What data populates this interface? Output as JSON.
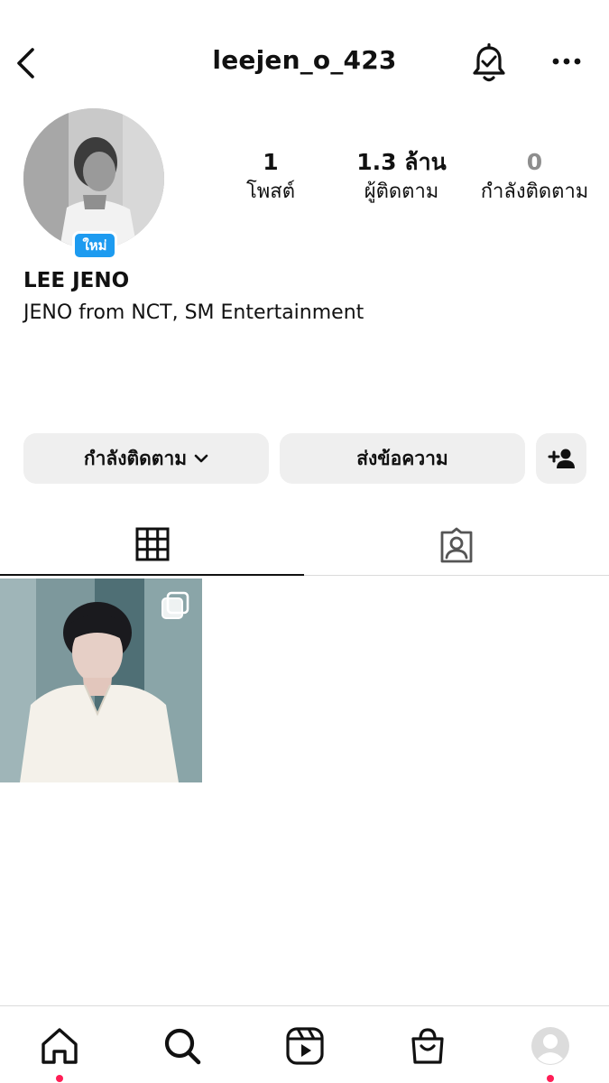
{
  "header": {
    "username": "leejen_o_423"
  },
  "profile": {
    "new_badge": "ใหม่",
    "display_name": "LEE JENO",
    "bio": "JENO from NCT, SM Entertainment",
    "stats": {
      "posts": {
        "value": "1",
        "label": "โพสต์"
      },
      "followers": {
        "value": "1.3 ล้าน",
        "label": "ผู้ติดตาม"
      },
      "following": {
        "value": "0",
        "label": "กำลังติดตาม"
      }
    }
  },
  "actions": {
    "following_label": "กำลังติดตาม",
    "message_label": "ส่งข้อความ"
  },
  "tabs": [
    {
      "icon": "grid-icon",
      "active": true
    },
    {
      "icon": "tagged-icon",
      "active": false
    }
  ],
  "posts": [
    {
      "type": "carousel"
    }
  ],
  "bottom_nav": [
    {
      "icon": "home-icon",
      "active": true,
      "notification_dot": true
    },
    {
      "icon": "search-icon"
    },
    {
      "icon": "reels-icon"
    },
    {
      "icon": "shop-icon"
    },
    {
      "icon": "profile-avatar-icon",
      "notification_dot": true
    }
  ],
  "colors": {
    "badge_blue": "#1d9bf0",
    "button_gray": "#efefef",
    "notification_dot": "#ff1e56",
    "muted_text": "#8e8e8e"
  }
}
